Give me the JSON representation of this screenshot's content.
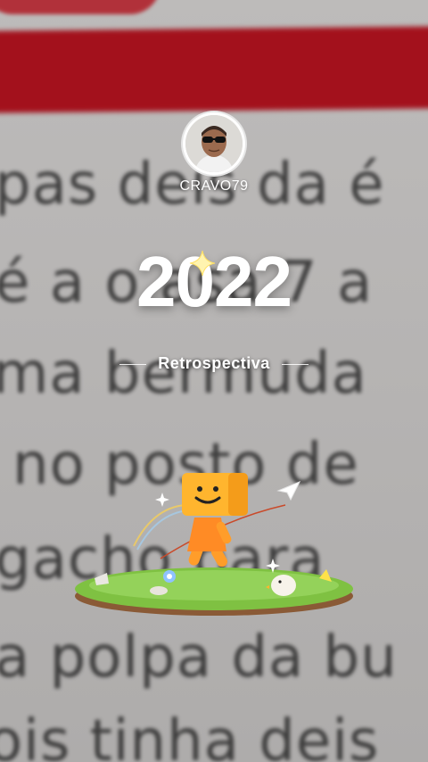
{
  "background": {
    "lines": [
      "pas deis da é",
      "é a o asa 7 a",
      "ma bermuda",
      "no posto de",
      "gacho para",
      "a polpa da bu",
      "ois tinha deis"
    ],
    "accent_red": "#a3111c"
  },
  "profile": {
    "username": "CRAVO79",
    "avatar": "avatar-icon"
  },
  "recap": {
    "year": "2022",
    "subtitle": "Retrospectiva"
  },
  "illustration": {
    "name": "mascot-on-grass-island",
    "mascot_color": "#f4a52a",
    "grass_color": "#7fc142"
  }
}
